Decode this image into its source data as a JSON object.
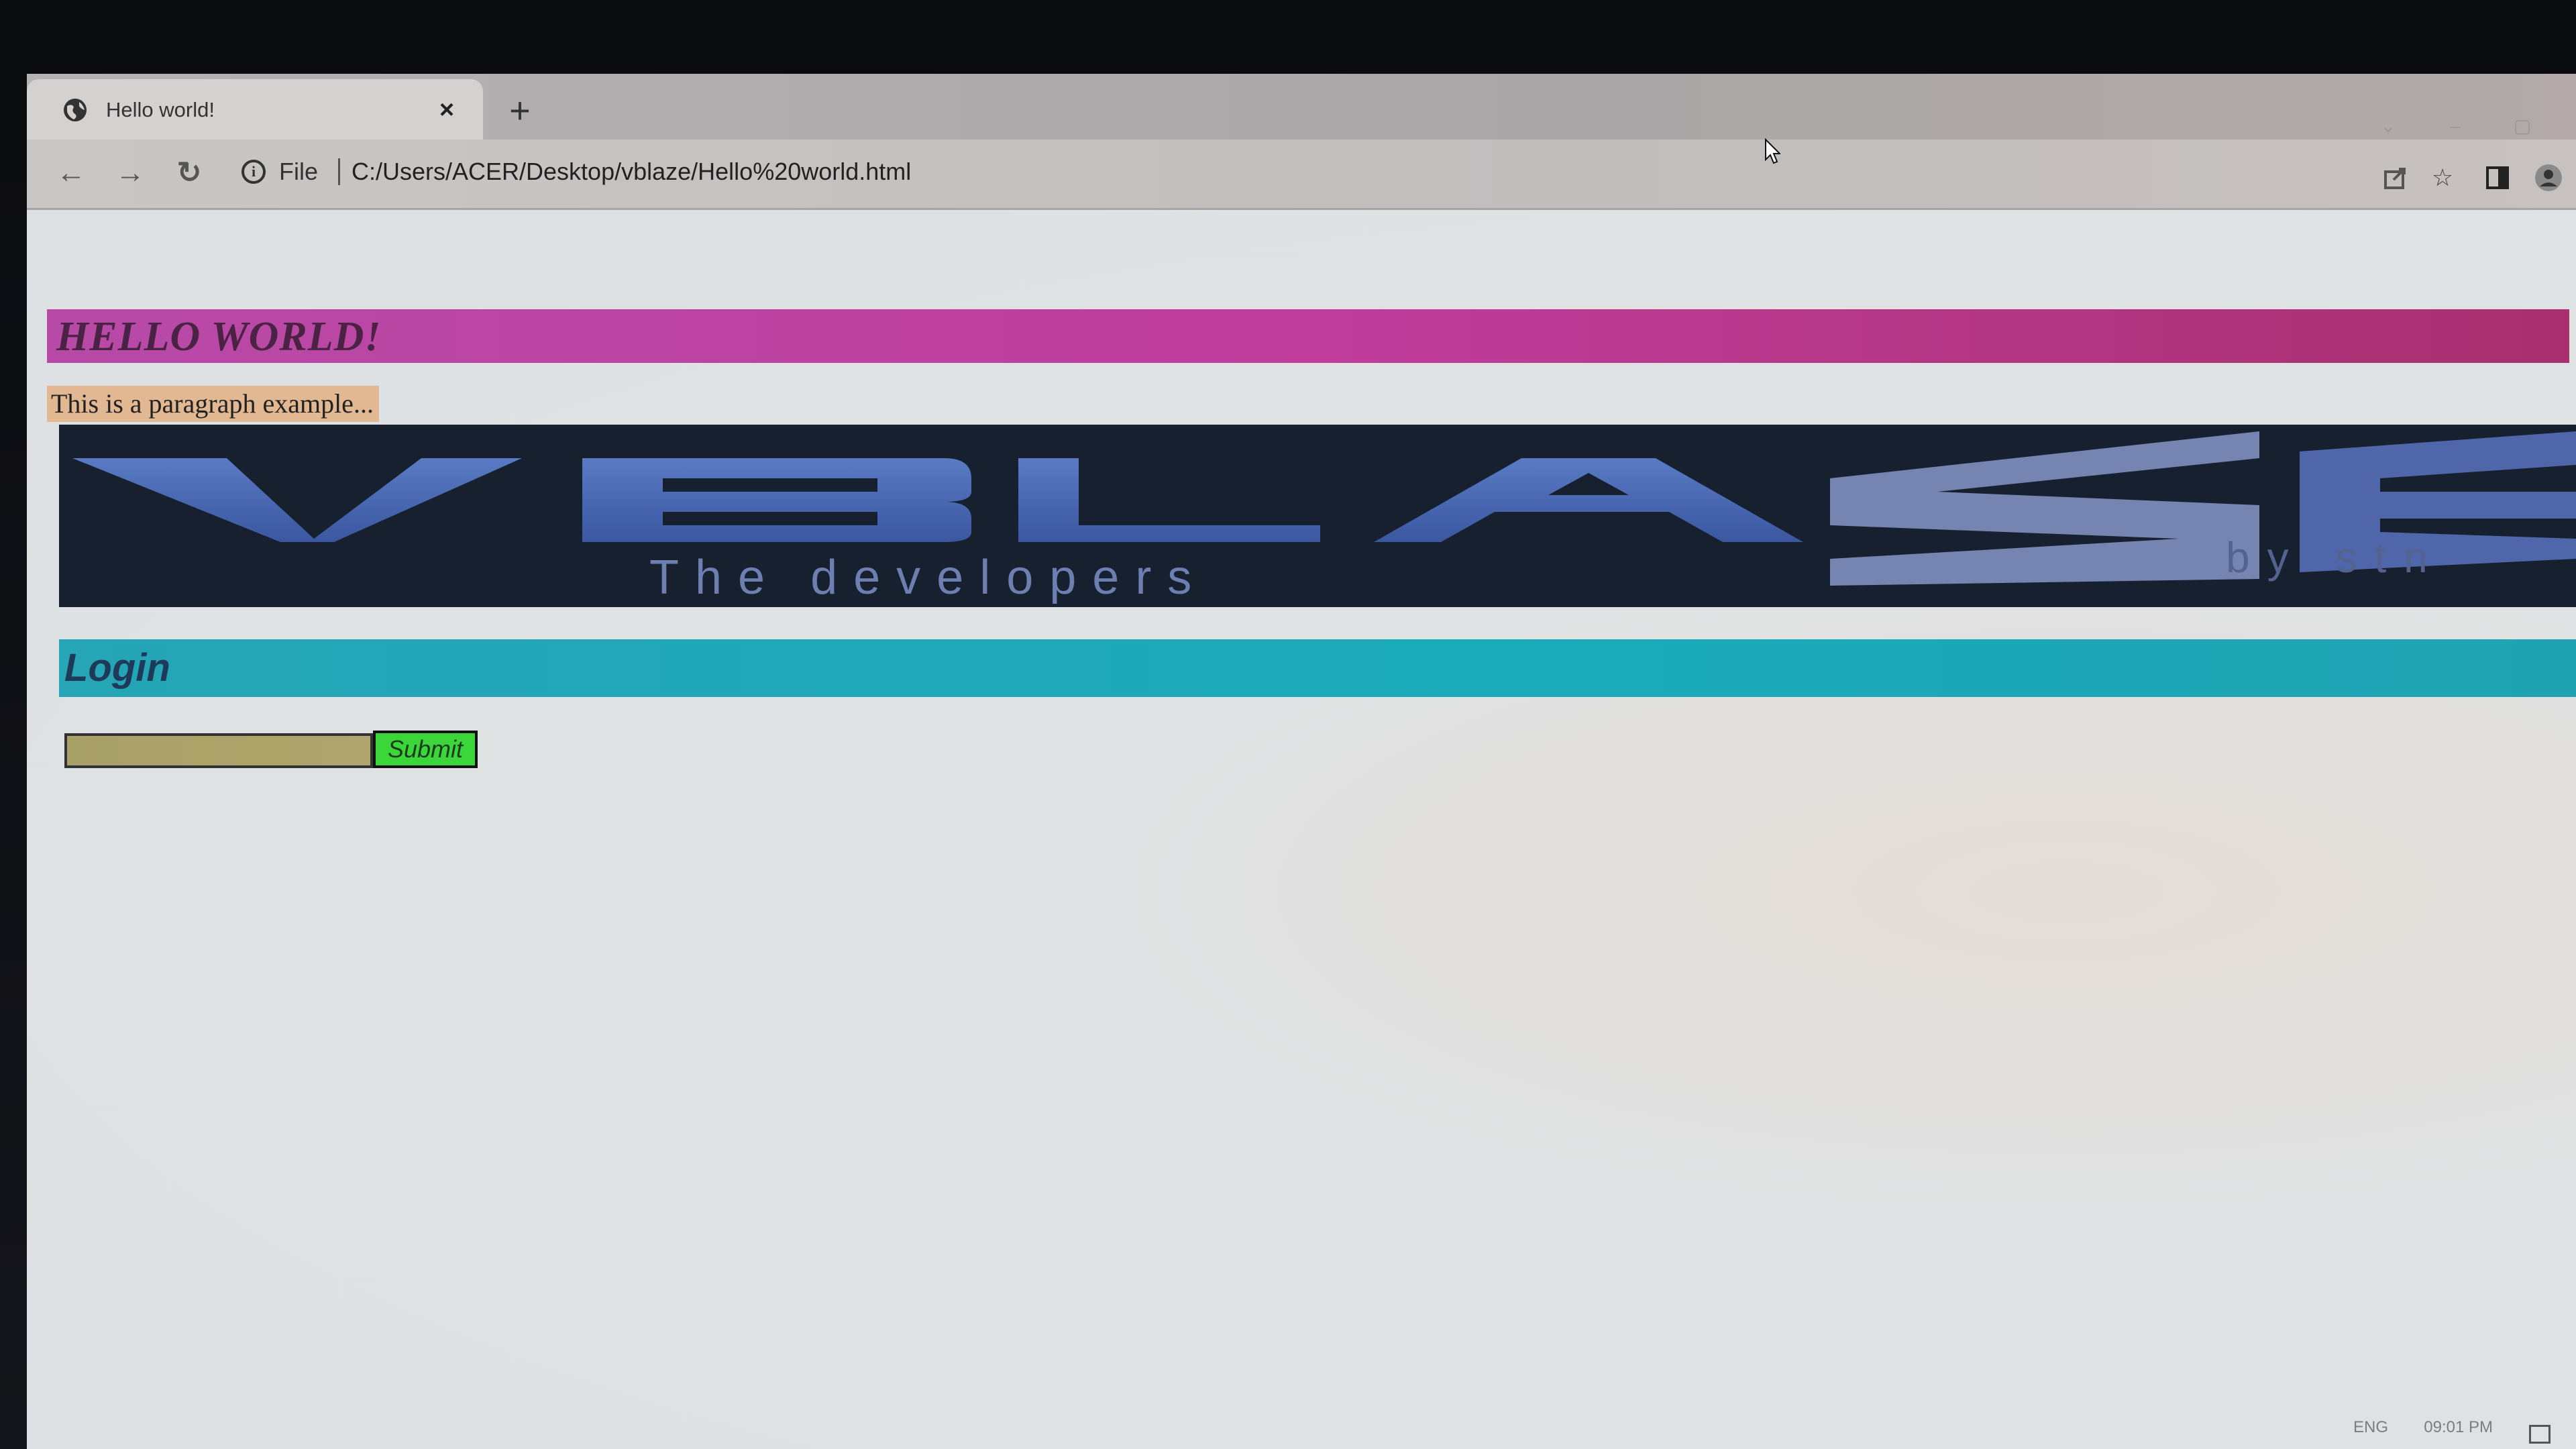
{
  "browser": {
    "tab_title": "Hello world!",
    "tab_close_glyph": "×",
    "new_tab_glyph": "+",
    "url_scheme_label": "File",
    "url": "C:/Users/ACER/Desktop/vblaze/Hello%20world.html",
    "icons": [
      "back-arrow-icon",
      "forward-arrow-icon",
      "reload-icon",
      "site-info-icon",
      "share-icon",
      "star-icon",
      "side-panel-icon",
      "profile-icon"
    ]
  },
  "page": {
    "heading": "HELLO WORLD!",
    "paragraph": "This is a paragraph example...",
    "banner": {
      "logo_text": "VBLASE",
      "tagline": "The developers",
      "tagline_right": "by stn"
    },
    "login": {
      "heading": "Login",
      "input_value": "",
      "submit_label": "Submit"
    }
  },
  "taskbar": {
    "clock": "09:01 PM",
    "lang": "ENG"
  },
  "colors": {
    "heading_bar": "#c03d9c",
    "paragraph_bg": "#e2b892",
    "login_bar": "#1aaab9",
    "submit_bg": "#3bd63a",
    "input_bg": "#aca36a",
    "banner_bg": "#16202e",
    "banner_letters": "#4a67b3"
  }
}
